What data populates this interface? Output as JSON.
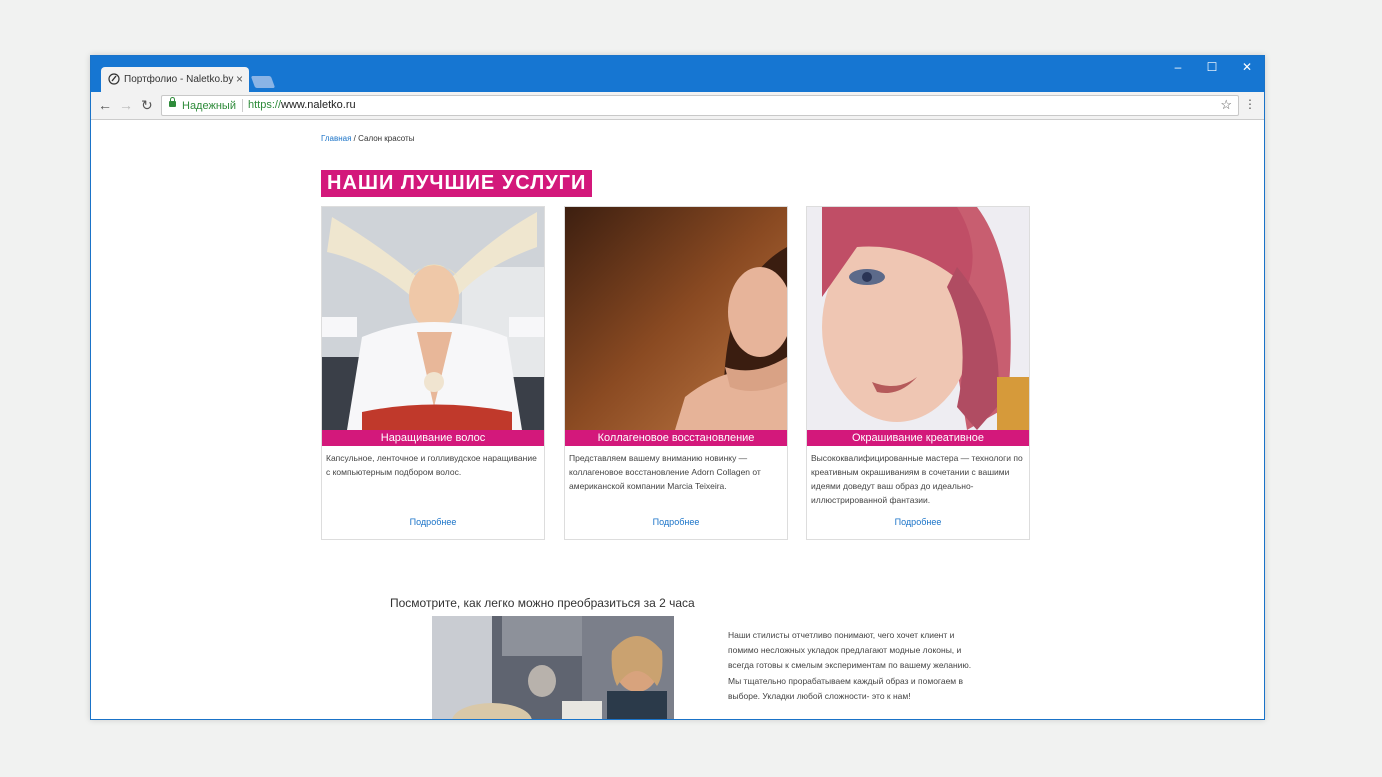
{
  "browser": {
    "tab_title": "Портфолио - Naletko.by",
    "tab_close": "×",
    "win_min": "–",
    "win_max": "☐",
    "win_close": "✕",
    "nav_back": "←",
    "nav_forward": "→",
    "nav_reload": "↻",
    "secure_label": "Надежный",
    "url_scheme": "https://",
    "url_host": "www.naletko.ru",
    "bookmark_icon": "☆",
    "menu_icon": "⋮"
  },
  "breadcrumb": {
    "home": "Главная",
    "separator": " / ",
    "current": "Салон красоты"
  },
  "section_title": "НАШИ ЛУЧШИЕ УСЛУГИ",
  "cards": [
    {
      "title": "Наращивание волос",
      "description": "Капсульное, ленточное и голливудское наращивание с компьютерным подбором волос.",
      "more": "Подробнее"
    },
    {
      "title": "Коллагеновое восстановление",
      "description": "Представляем вашему вниманию новинку — коллагеновое восстановление Adorn Collagen от американской компании Marcia Teixeira.",
      "more": "Подробнее"
    },
    {
      "title": "Окрашивание креативное",
      "description": "Высококвалифицированные мастера — технологи по креативным окрашиваниям в сочетании с вашими идеями доведут ваш образ до идеально-иллюстрированной фантазии.",
      "more": "Подробнее"
    }
  ],
  "transform": {
    "heading": "Посмотрите, как легко можно преобразиться за 2 часа",
    "text": "Наши стилисты отчетливо понимают, чего хочет клиент  и помимо несложных укладок предлагают модные локоны, и всегда готовы к смелым экспериментам по вашему желанию. Мы тщательно прорабатываем каждый образ и помогаем в  выборе. Укладки любой сложности- это к нам!"
  },
  "colors": {
    "accent": "#d3187b",
    "chrome_blue": "#1676d2",
    "link": "#1a73c8"
  }
}
